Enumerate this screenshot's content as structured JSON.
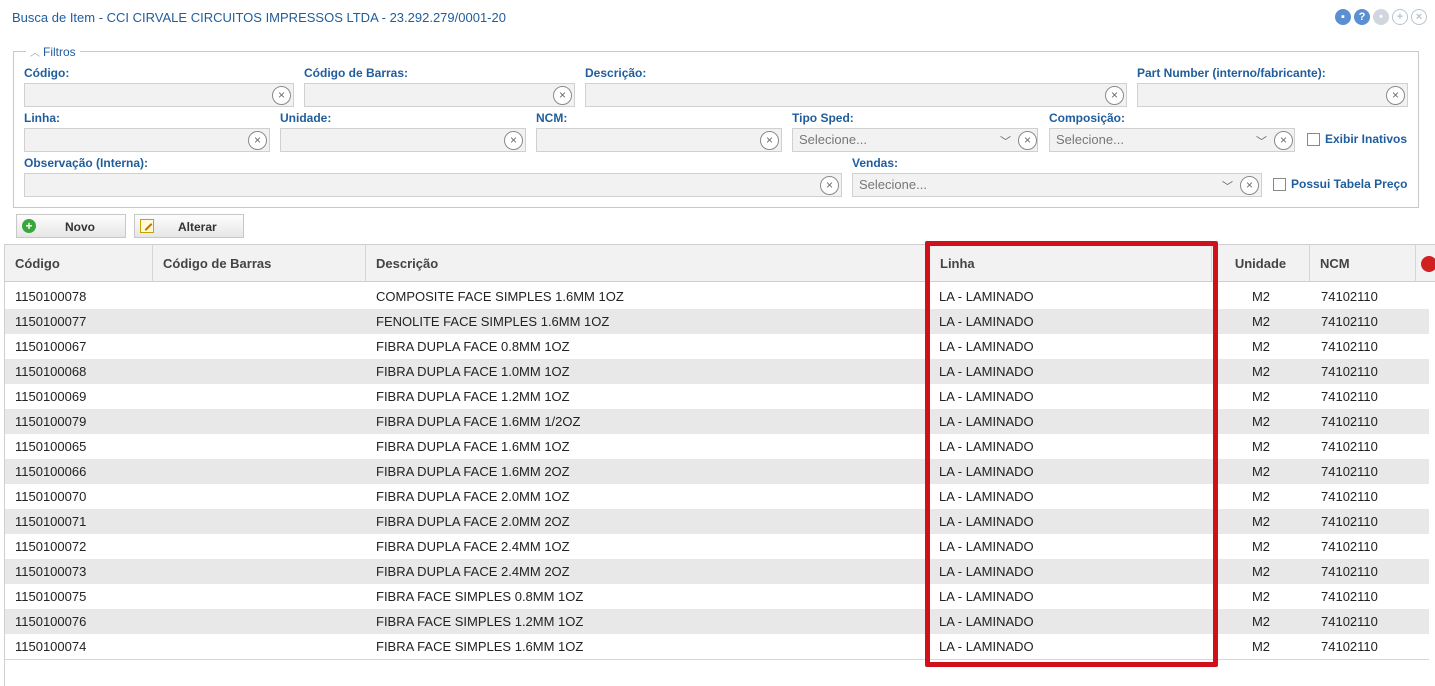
{
  "window": {
    "title": "Busca de Item - CCI CIRVALE CIRCUITOS IMPRESSOS LTDA - 23.292.279/0001-20",
    "icons": [
      "refresh-icon",
      "help-icon",
      "settings-icon",
      "expand-icon",
      "close-icon"
    ]
  },
  "filters": {
    "legend": "Filtros",
    "codigo": {
      "label": "Código:",
      "value": ""
    },
    "codigo_barras": {
      "label": "Código de Barras:",
      "value": ""
    },
    "descricao": {
      "label": "Descrição:",
      "value": ""
    },
    "part_number": {
      "label": "Part Number (interno/fabricante):",
      "value": ""
    },
    "linha": {
      "label": "Linha:",
      "value": ""
    },
    "unidade": {
      "label": "Unidade:",
      "value": ""
    },
    "ncm": {
      "label": "NCM:",
      "value": ""
    },
    "tipo_sped": {
      "label": "Tipo Sped:",
      "value": "Selecione..."
    },
    "composicao": {
      "label": "Composição:",
      "value": "Selecione..."
    },
    "exibir_inativos": {
      "label": "Exibir Inativos",
      "checked": false
    },
    "observacao": {
      "label": "Observação (Interna):",
      "value": ""
    },
    "vendas": {
      "label": "Vendas:",
      "value": "Selecione..."
    },
    "possui_tabela": {
      "label": "Possui Tabela Preço",
      "checked": false
    }
  },
  "toolbar": {
    "novo_label": "Novo",
    "alterar_label": "Alterar"
  },
  "table": {
    "columns": [
      "Código",
      "Código de Barras",
      "Descrição",
      "Linha",
      "Unidade",
      "NCM"
    ],
    "rows": [
      {
        "codigo": "1150100078",
        "barras": "",
        "descricao": "COMPOSITE FACE SIMPLES 1.6MM 1OZ",
        "linha": "LA - LAMINADO",
        "unidade": "M2",
        "ncm": "74102110"
      },
      {
        "codigo": "1150100077",
        "barras": "",
        "descricao": "FENOLITE FACE SIMPLES 1.6MM 1OZ",
        "linha": "LA - LAMINADO",
        "unidade": "M2",
        "ncm": "74102110"
      },
      {
        "codigo": "1150100067",
        "barras": "",
        "descricao": "FIBRA DUPLA FACE 0.8MM 1OZ",
        "linha": "LA - LAMINADO",
        "unidade": "M2",
        "ncm": "74102110"
      },
      {
        "codigo": "1150100068",
        "barras": "",
        "descricao": "FIBRA DUPLA FACE 1.0MM 1OZ",
        "linha": "LA - LAMINADO",
        "unidade": "M2",
        "ncm": "74102110"
      },
      {
        "codigo": "1150100069",
        "barras": "",
        "descricao": "FIBRA DUPLA FACE 1.2MM 1OZ",
        "linha": "LA - LAMINADO",
        "unidade": "M2",
        "ncm": "74102110"
      },
      {
        "codigo": "1150100079",
        "barras": "",
        "descricao": "FIBRA DUPLA FACE 1.6MM 1/2OZ",
        "linha": "LA - LAMINADO",
        "unidade": "M2",
        "ncm": "74102110"
      },
      {
        "codigo": "1150100065",
        "barras": "",
        "descricao": "FIBRA DUPLA FACE 1.6MM 1OZ",
        "linha": "LA - LAMINADO",
        "unidade": "M2",
        "ncm": "74102110"
      },
      {
        "codigo": "1150100066",
        "barras": "",
        "descricao": "FIBRA DUPLA FACE 1.6MM 2OZ",
        "linha": "LA - LAMINADO",
        "unidade": "M2",
        "ncm": "74102110"
      },
      {
        "codigo": "1150100070",
        "barras": "",
        "descricao": "FIBRA DUPLA FACE 2.0MM 1OZ",
        "linha": "LA - LAMINADO",
        "unidade": "M2",
        "ncm": "74102110"
      },
      {
        "codigo": "1150100071",
        "barras": "",
        "descricao": "FIBRA DUPLA FACE 2.0MM 2OZ",
        "linha": "LA - LAMINADO",
        "unidade": "M2",
        "ncm": "74102110"
      },
      {
        "codigo": "1150100072",
        "barras": "",
        "descricao": "FIBRA DUPLA FACE 2.4MM 1OZ",
        "linha": "LA - LAMINADO",
        "unidade": "M2",
        "ncm": "74102110"
      },
      {
        "codigo": "1150100073",
        "barras": "",
        "descricao": "FIBRA DUPLA FACE 2.4MM 2OZ",
        "linha": "LA - LAMINADO",
        "unidade": "M2",
        "ncm": "74102110"
      },
      {
        "codigo": "1150100075",
        "barras": "",
        "descricao": "FIBRA FACE SIMPLES 0.8MM 1OZ",
        "linha": "LA - LAMINADO",
        "unidade": "M2",
        "ncm": "74102110"
      },
      {
        "codigo": "1150100076",
        "barras": "",
        "descricao": "FIBRA FACE SIMPLES 1.2MM 1OZ",
        "linha": "LA - LAMINADO",
        "unidade": "M2",
        "ncm": "74102110"
      },
      {
        "codigo": "1150100074",
        "barras": "",
        "descricao": "FIBRA FACE SIMPLES 1.6MM 1OZ",
        "linha": "LA - LAMINADO",
        "unidade": "M2",
        "ncm": "74102110"
      }
    ]
  },
  "colors": {
    "label_blue": "#1f5d9c",
    "highlight_red": "#d0101a",
    "row_alt": "#e8e8e8"
  }
}
